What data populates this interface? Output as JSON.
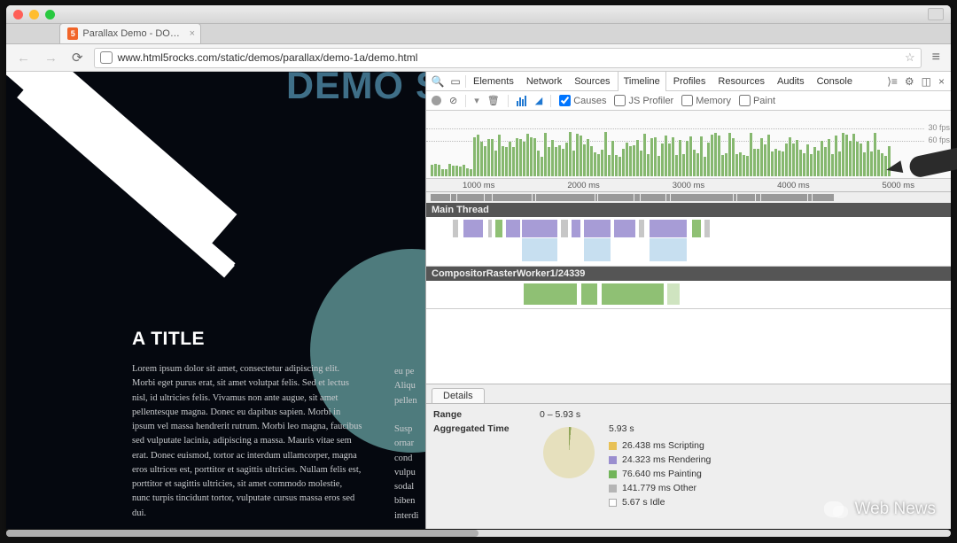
{
  "browser": {
    "tab_title": "Parallax Demo - DOM + A",
    "url": "www.html5rocks.com/static/demos/parallax/demo-1a/demo.html"
  },
  "page": {
    "big_title": "DEMO S",
    "heading": "A TITLE",
    "para": "Lorem ipsum dolor sit amet, consectetur adipiscing elit. Morbi eget purus erat, sit amet volutpat felis. Sed et lectus nisl, id ultricies felis. Vivamus non ante augue, sit amet pellentesque magna. Donec eu dapibus sapien. Morbi in ipsum vel massa hendrerit rutrum. Morbi leo magna, faucibus sed vulputate lacinia, adipiscing a massa. Mauris vitae sem erat. Donec euismod, tortor ac interdum ullamcorper, magna eros ultrices est, porttitor et sagittis ultricies. Nullam felis est, porttitor et sagittis ultricies, sit amet commodo molestie, nunc turpis tincidunt tortor, vulputate cursus massa eros sed dui.",
    "col2_lines": [
      "eu pe",
      "Aliqu",
      "pellen",
      "",
      "Susp",
      "ornar",
      "cond",
      "vulpu",
      "sodal",
      "biben",
      "interdi"
    ]
  },
  "devtools": {
    "tabs": [
      "Elements",
      "Network",
      "Sources",
      "Timeline",
      "Profiles",
      "Resources",
      "Audits",
      "Console"
    ],
    "active_tab": "Timeline",
    "checkboxes": {
      "causes": {
        "label": "Causes",
        "checked": true
      },
      "js": {
        "label": "JS Profiler",
        "checked": false
      },
      "memory": {
        "label": "Memory",
        "checked": false
      },
      "paint": {
        "label": "Paint",
        "checked": false
      }
    },
    "fps_labels": {
      "thirty": "30 fps",
      "sixty": "60 fps"
    },
    "time_ticks": [
      "1000 ms",
      "2000 ms",
      "3000 ms",
      "4000 ms",
      "5000 ms"
    ],
    "threads": {
      "main": "Main Thread",
      "raster": "CompositorRasterWorker1/24339"
    },
    "details_tab": "Details",
    "range_label": "Range",
    "range_value": "0 – 5.93 s",
    "agg_label": "Aggregated Time",
    "legend": {
      "total": "5.93 s",
      "items": [
        {
          "color": "#e8c156",
          "text": "26.438 ms Scripting"
        },
        {
          "color": "#9a8ecf",
          "text": "24.323 ms Rendering"
        },
        {
          "color": "#72b55a",
          "text": "76.640 ms Painting"
        },
        {
          "color": "#b5b5b5",
          "text": "141.779 ms Other"
        },
        {
          "color": "#ffffff",
          "text": "5.67 s Idle"
        }
      ]
    }
  },
  "watermark": "Web News"
}
